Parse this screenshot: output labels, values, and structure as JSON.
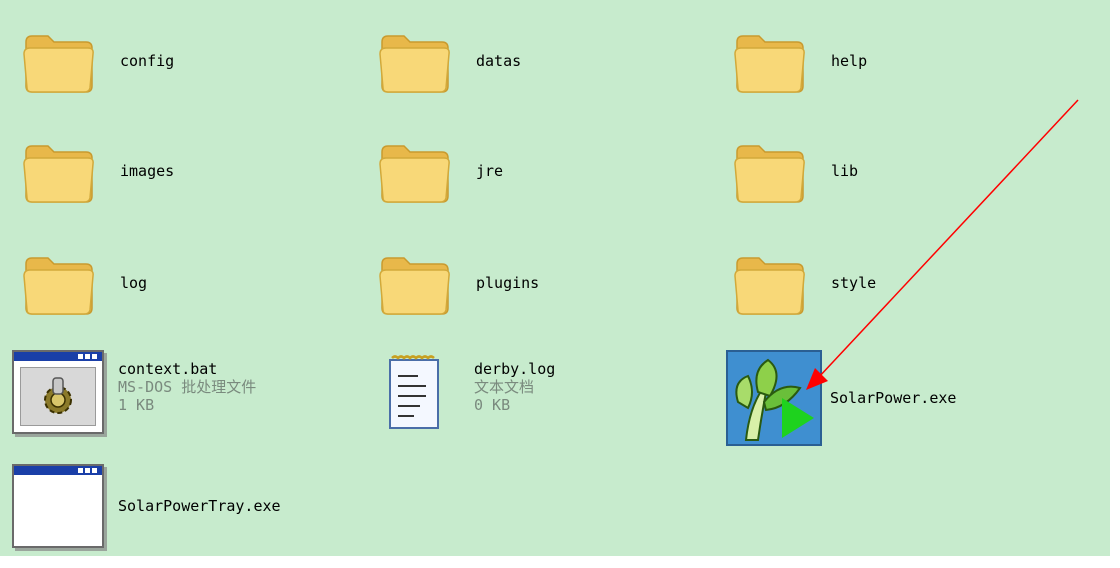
{
  "items": [
    {
      "name": "config",
      "type": "folder"
    },
    {
      "name": "datas",
      "type": "folder"
    },
    {
      "name": "help",
      "type": "folder"
    },
    {
      "name": "images",
      "type": "folder"
    },
    {
      "name": "jre",
      "type": "folder"
    },
    {
      "name": "lib",
      "type": "folder"
    },
    {
      "name": "log",
      "type": "folder"
    },
    {
      "name": "plugins",
      "type": "folder"
    },
    {
      "name": "style",
      "type": "folder"
    },
    {
      "name": "context.bat",
      "type": "batch-file",
      "kind": "MS-DOS 批处理文件",
      "size": "1 KB"
    },
    {
      "name": "derby.log",
      "type": "text-file",
      "kind": "文本文档",
      "size": "0 KB"
    },
    {
      "name": "SolarPower.exe",
      "type": "application"
    },
    {
      "name": "SolarPowerTray.exe",
      "type": "application"
    }
  ],
  "colors": {
    "background": "#c7ebcd",
    "annotation_arrow": "#ff0000",
    "folder_fill": "#f8d878",
    "app_icon_blue": "#3f8fd0",
    "play_green": "#1ed21e"
  },
  "icons": {
    "folder": "folder-icon",
    "batch": "batch-file-icon",
    "text": "notepad-icon",
    "solar": "solarpower-app-icon",
    "tray": "application-window-icon"
  }
}
